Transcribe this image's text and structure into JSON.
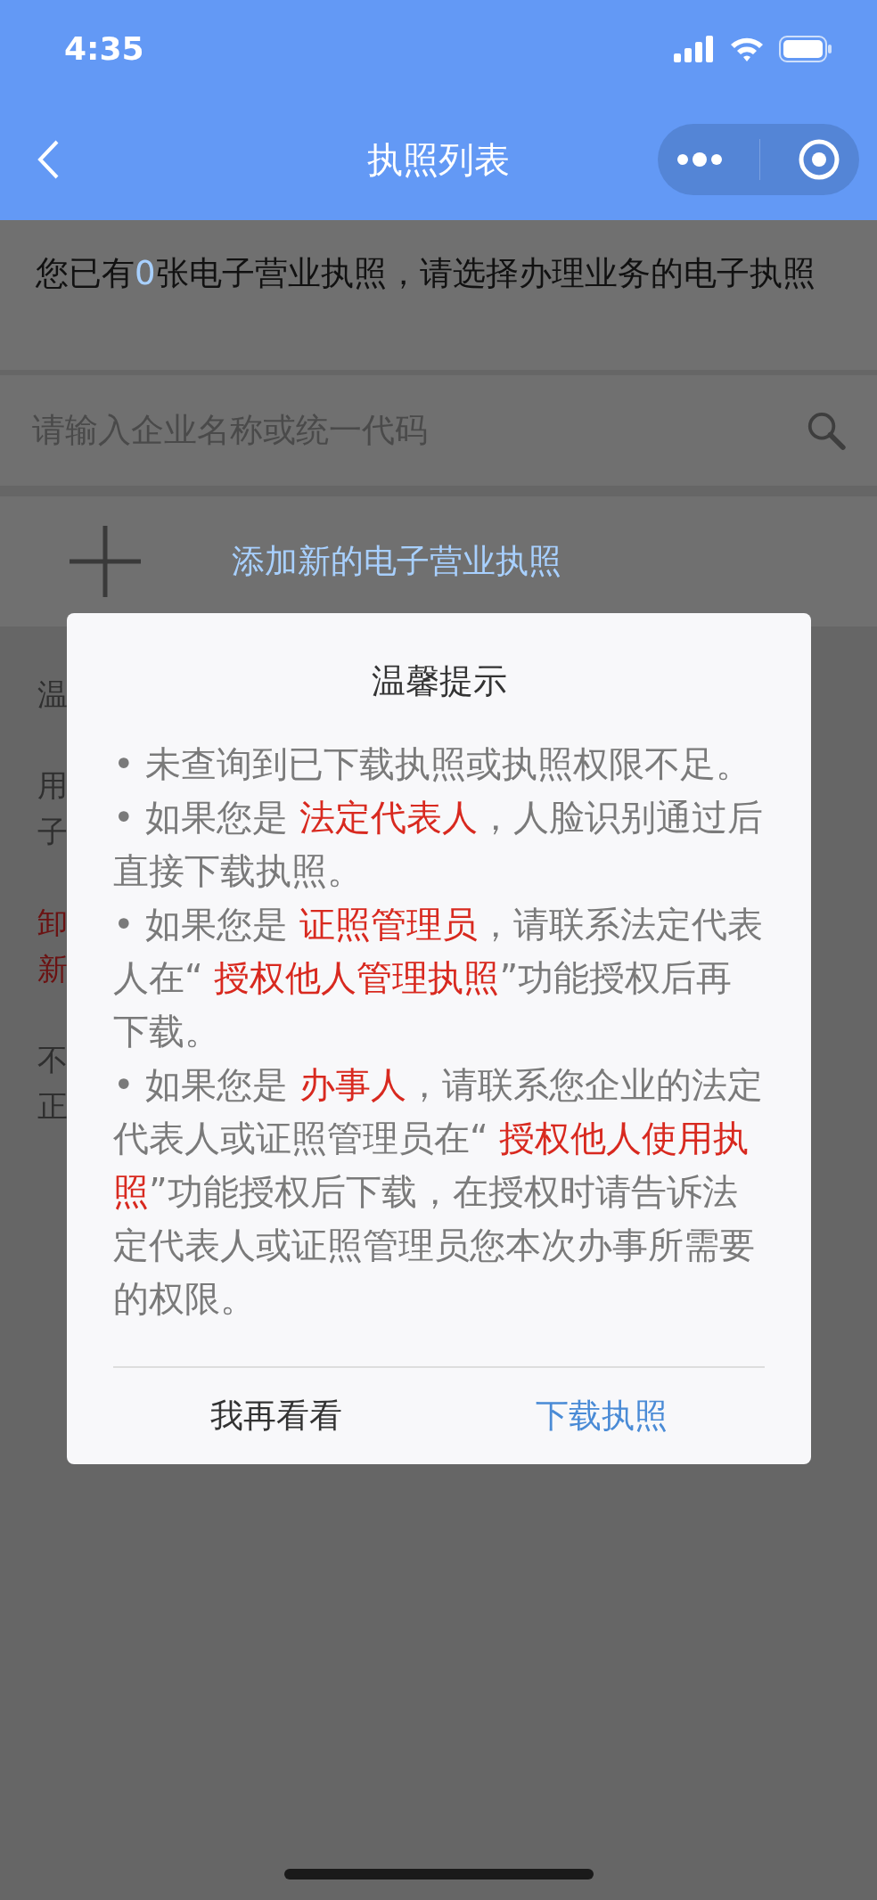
{
  "status_bar": {
    "time": "4:35"
  },
  "nav": {
    "title": "执照列表"
  },
  "info": [
    {
      "text": "您已有",
      "emphasis": false
    },
    {
      "text": "0",
      "emphasis": true
    },
    {
      "text": "张电子营业执照，请选择办理业务的电子执照",
      "emphasis": false
    }
  ],
  "search": {
    "placeholder": "请输入企业名称或统一代码"
  },
  "add_button": {
    "label": "添加新的电子营业执照"
  },
  "background_notes": [
    {
      "lines": [
        {
          "text": "温",
          "emphasis": false
        }
      ]
    },
    {
      "lines": [
        {
          "text": "用",
          "emphasis": false
        },
        {
          "text": "子",
          "emphasis": false
        }
      ]
    },
    {
      "lines": [
        {
          "text": "卸",
          "emphasis": true
        },
        {
          "text": "新",
          "emphasis": true
        }
      ]
    },
    {
      "lines": [
        {
          "text": "不",
          "emphasis": false
        },
        {
          "text": "正",
          "emphasis": false
        }
      ]
    }
  ],
  "dialog": {
    "title": "温馨提示",
    "paragraphs": [
      [
        {
          "text": "• 未查询到已下载执照或执照权限不足。",
          "emphasis": false
        }
      ],
      [
        {
          "text": "• 如果您是 ",
          "emphasis": false
        },
        {
          "text": "法定代表人",
          "emphasis": true
        },
        {
          "text": "，人脸识别通过后直接下载执照。",
          "emphasis": false
        }
      ],
      [
        {
          "text": "• 如果您是 ",
          "emphasis": false
        },
        {
          "text": "证照管理员",
          "emphasis": true
        },
        {
          "text": "，请联系法定代表人在“ ",
          "emphasis": false
        },
        {
          "text": "授权他人管理执照",
          "emphasis": true
        },
        {
          "text": "”功能授权后再下载。",
          "emphasis": false
        }
      ],
      [
        {
          "text": "• 如果您是 ",
          "emphasis": false
        },
        {
          "text": "办事人",
          "emphasis": true
        },
        {
          "text": "，请联系您企业的法定代表人或证照管理员在“ ",
          "emphasis": false
        },
        {
          "text": "授权他人使用执照",
          "emphasis": true
        },
        {
          "text": "”功能授权后下载，在授权时请告诉法定代表人或证照管理员您本次办事所需要的权限。",
          "emphasis": false
        }
      ]
    ],
    "buttons": [
      {
        "label": "我再看看",
        "kind": "cancel"
      },
      {
        "label": "下载执照",
        "kind": "confirm"
      }
    ]
  }
}
